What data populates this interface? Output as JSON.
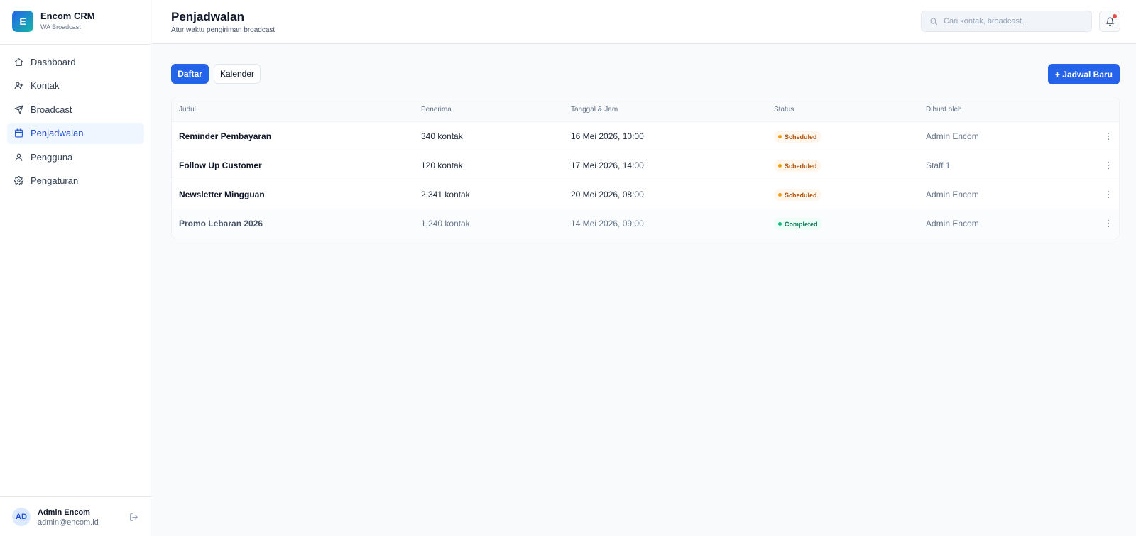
{
  "brand": {
    "logo_letter": "E",
    "name": "Encom CRM",
    "subtitle": "WA Broadcast"
  },
  "sidebar": {
    "items": [
      {
        "label": "Dashboard",
        "icon": "home-icon"
      },
      {
        "label": "Kontak",
        "icon": "user-plus-icon"
      },
      {
        "label": "Broadcast",
        "icon": "send-icon"
      },
      {
        "label": "Penjadwalan",
        "icon": "calendar-icon",
        "active": true
      },
      {
        "label": "Pengguna",
        "icon": "user-icon"
      },
      {
        "label": "Pengaturan",
        "icon": "gear-icon"
      }
    ]
  },
  "user": {
    "initials": "AD",
    "name": "Admin Encom",
    "email": "admin@encom.id"
  },
  "header": {
    "title": "Penjadwalan",
    "subtitle": "Atur waktu pengiriman broadcast",
    "search_placeholder": "Cari kontak, broadcast..."
  },
  "toolbar": {
    "tab_list": "Daftar",
    "tab_calendar": "Kalender",
    "new_button": "+ Jadwal Baru"
  },
  "table": {
    "columns": [
      "Judul",
      "Penerima",
      "Tanggal & Jam",
      "Status",
      "Dibuat oleh"
    ],
    "rows": [
      {
        "title": "Reminder Pembayaran",
        "recipients": "340 kontak",
        "datetime": "16 Mei 2026, 10:00",
        "status": "Scheduled",
        "creator": "Admin Encom"
      },
      {
        "title": "Follow Up Customer",
        "recipients": "120 kontak",
        "datetime": "17 Mei 2026, 14:00",
        "status": "Scheduled",
        "creator": "Staff 1"
      },
      {
        "title": "Newsletter Mingguan",
        "recipients": "2,341 kontak",
        "datetime": "20 Mei 2026, 08:00",
        "status": "Scheduled",
        "creator": "Admin Encom"
      },
      {
        "title": "Promo Lebaran 2026",
        "recipients": "1,240 kontak",
        "datetime": "14 Mei 2026, 09:00",
        "status": "Completed",
        "creator": "Admin Encom"
      }
    ]
  },
  "colors": {
    "primary": "#2563eb",
    "scheduled": "#f59e0b",
    "completed": "#10b981",
    "notification": "#ef4444"
  }
}
